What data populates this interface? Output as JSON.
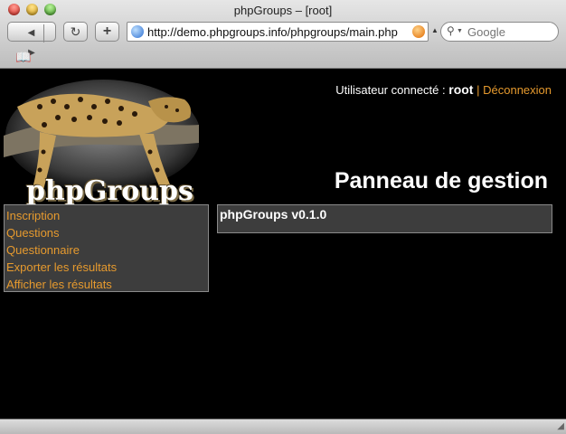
{
  "window": {
    "title": "phpGroups – [root]"
  },
  "toolbar": {
    "back_icon": "◀",
    "forward_icon": "▶",
    "reload_icon": "↻",
    "add_bookmark_icon": "+",
    "url": "http://demo.phpgroups.info/phpgroups/main.php",
    "search_placeholder": "Google"
  },
  "bookmarks_bar": {
    "icon": "book-icon"
  },
  "header": {
    "user_label": "Utilisateur connecté :",
    "username": "root",
    "separator": "|",
    "logout_label": "Déconnexion",
    "logo_text": "phpGroups",
    "page_heading": "Panneau de gestion"
  },
  "sidebar": {
    "items": [
      {
        "label": "Inscription"
      },
      {
        "label": "Questions"
      },
      {
        "label": "Questionnaire"
      },
      {
        "label": "Exporter les résultats"
      },
      {
        "label": "Afficher les résultats"
      }
    ]
  },
  "main": {
    "version_text": "phpGroups v0.1.0"
  },
  "colors": {
    "link": "#e69a2e",
    "panel_bg": "#3d3d3d",
    "page_bg": "#000000"
  }
}
